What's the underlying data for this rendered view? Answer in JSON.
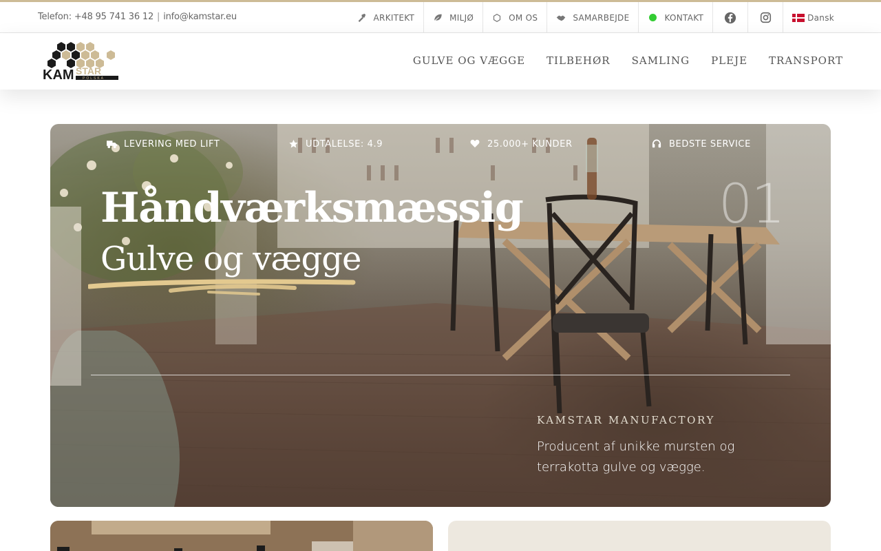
{
  "topbar": {
    "phone": "Telefon: +48 95 741 36 12",
    "separator": "|",
    "email": "info@kamstar.eu",
    "links": [
      {
        "label": "ARKITEKT",
        "icon": "hammer-icon"
      },
      {
        "label": "MILJØ",
        "icon": "leaf-icon"
      },
      {
        "label": "OM OS",
        "icon": "hexagon-icon"
      },
      {
        "label": "SAMARBEJDE",
        "icon": "handshake-icon"
      },
      {
        "label": "KONTAKT",
        "icon": "green-dot-icon"
      }
    ],
    "social": [
      {
        "icon": "facebook-icon"
      },
      {
        "icon": "instagram-icon"
      }
    ],
    "language": "Dansk"
  },
  "header": {
    "logo_text": "KAMSTAR",
    "logo_subtext": "POLSKA",
    "nav": [
      "GULVE OG VÆGGE",
      "TILBEHØR",
      "SAMLING",
      "PLEJE",
      "TRANSPORT"
    ]
  },
  "hero": {
    "features": [
      {
        "label": "LEVERING MED LIFT",
        "icon": "truck-icon"
      },
      {
        "label": "UDTALELSE: 4.9",
        "icon": "star-icon"
      },
      {
        "label": "25.000+ KUNDER",
        "icon": "heart-icon"
      },
      {
        "label": "BEDSTE SERVICE",
        "icon": "headset-icon"
      }
    ],
    "slide_number": "01",
    "title": "Håndværksmæssig",
    "subtitle": "Gulve og vægge",
    "eyebrow": "KAMSTAR MANUFACTORY",
    "description": "Producent af unikke mursten og terrakotta gulve og vægge."
  },
  "colors": {
    "accent": "#cdbb96",
    "brush": "#e3c98f",
    "contact_dot": "#33cc33",
    "card_right_bg": "#ede8df"
  }
}
